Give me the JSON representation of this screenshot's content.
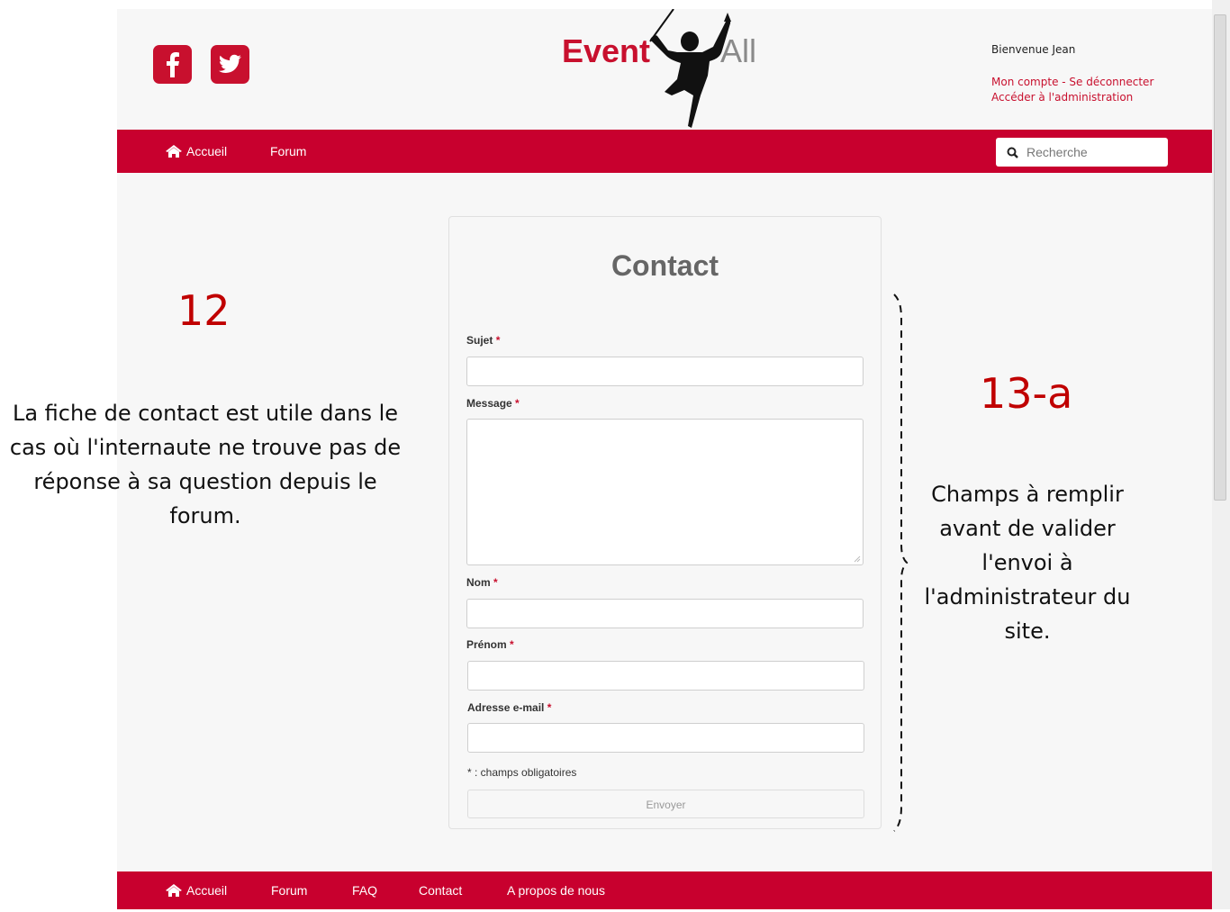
{
  "header": {
    "logo_left": "Event",
    "logo_right": "All",
    "welcome": "Bienvenue Jean",
    "account_links": "Mon compte - Se déconnecter",
    "admin_link": "Accéder à l'administration"
  },
  "navbar": {
    "items": [
      {
        "label": "Accueil",
        "icon": "home-icon"
      },
      {
        "label": "Forum"
      }
    ],
    "search_placeholder": "Recherche"
  },
  "form": {
    "title": "Contact",
    "fields": [
      {
        "label": "Sujet",
        "value": ""
      },
      {
        "label": "Message",
        "value": ""
      },
      {
        "label": "Nom",
        "value": ""
      },
      {
        "label": "Prénom",
        "value": ""
      },
      {
        "label": "Adresse e-mail",
        "value": ""
      }
    ],
    "required_mark": "*",
    "required_note": "* : champs obligatoires",
    "submit": "Envoyer"
  },
  "footer": {
    "items": [
      {
        "label": "Accueil",
        "icon": "home-icon"
      },
      {
        "label": "Forum"
      },
      {
        "label": "FAQ"
      },
      {
        "label": "Contact"
      },
      {
        "label": "A propos de nous"
      }
    ]
  },
  "annotations": {
    "left_number": "12",
    "left_text": "La fiche de contact est utile dans le cas où l'internaute ne trouve pas de réponse à sa question depuis le forum.",
    "right_number": "13-a",
    "right_text": "Champs à remplir avant de valider l'envoi à l'administrateur du site."
  },
  "colors": {
    "brand_red": "#c8002e",
    "annotation_red": "#c00000"
  }
}
